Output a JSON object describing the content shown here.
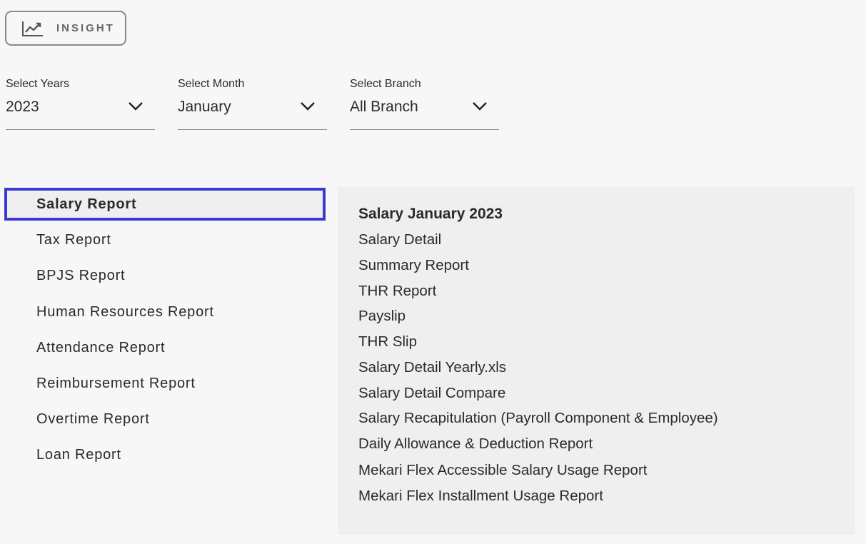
{
  "insight": {
    "label": "INSIGHT"
  },
  "filters": {
    "years": {
      "label": "Select Years",
      "value": "2023"
    },
    "month": {
      "label": "Select Month",
      "value": "January"
    },
    "branch": {
      "label": "Select Branch",
      "value": "All Branch"
    }
  },
  "menu": {
    "items": [
      {
        "label": "Salary Report",
        "active": true
      },
      {
        "label": "Tax Report"
      },
      {
        "label": "BPJS Report"
      },
      {
        "label": "Human Resources Report"
      },
      {
        "label": "Attendance Report"
      },
      {
        "label": "Reimbursement Report"
      },
      {
        "label": "Overtime Report"
      },
      {
        "label": "Loan Report"
      }
    ]
  },
  "panel": {
    "title": "Salary January 2023",
    "links": [
      "Salary Detail",
      "Summary Report",
      "THR Report",
      "Payslip",
      "THR Slip",
      "Salary Detail Yearly.xls",
      "Salary Detail Compare",
      "Salary Recapitulation (Payroll Component & Employee)",
      "Daily Allowance & Deduction Report",
      "Mekari Flex Accessible Salary Usage Report",
      "Mekari Flex Installment Usage Report"
    ]
  },
  "colors": {
    "active_border": "#3a3ad0",
    "panel_bg": "#efefef",
    "page_bg": "#f7f7f7"
  }
}
